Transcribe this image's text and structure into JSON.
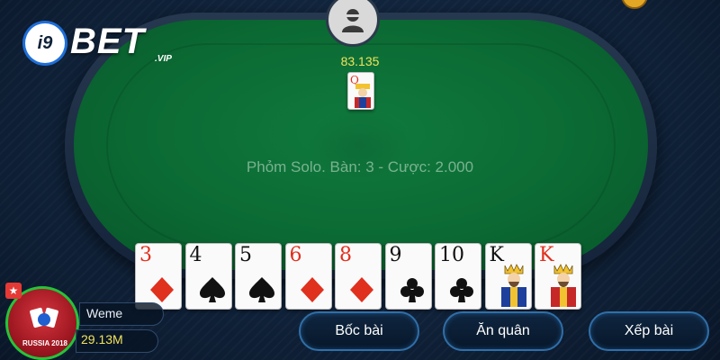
{
  "logo": {
    "badge": "i9",
    "text": "BET",
    "sub": ".VIP"
  },
  "opponent": {
    "money": "83.135",
    "card_rank": "Q"
  },
  "table": {
    "info": "Phỏm Solo. Bàn: 3 - Cược: 2.000"
  },
  "hand": [
    {
      "rank": "3",
      "suit": "diamond",
      "color": "red"
    },
    {
      "rank": "4",
      "suit": "spade",
      "color": "black"
    },
    {
      "rank": "5",
      "suit": "spade",
      "color": "black"
    },
    {
      "rank": "6",
      "suit": "diamond",
      "color": "red"
    },
    {
      "rank": "8",
      "suit": "diamond",
      "color": "red"
    },
    {
      "rank": "9",
      "suit": "club",
      "color": "black"
    },
    {
      "rank": "10",
      "suit": "club",
      "color": "black"
    },
    {
      "rank": "K",
      "suit": "spade",
      "color": "black"
    },
    {
      "rank": "K",
      "suit": "diamond",
      "color": "red"
    }
  ],
  "player": {
    "name": "Weme",
    "money": "29.13M",
    "avatar_caption": "RUSSIA 2018"
  },
  "actions": {
    "draw": "Bốc bài",
    "eat": "Ăn quân",
    "arrange": "Xếp bài"
  },
  "colors": {
    "felt": "#0b6a33",
    "background": "#0f2138",
    "money_yellow": "#f2e35c",
    "suit_red": "#e0301e",
    "avatar_ring": "#25c43a",
    "button_border": "#2f6fa8"
  }
}
